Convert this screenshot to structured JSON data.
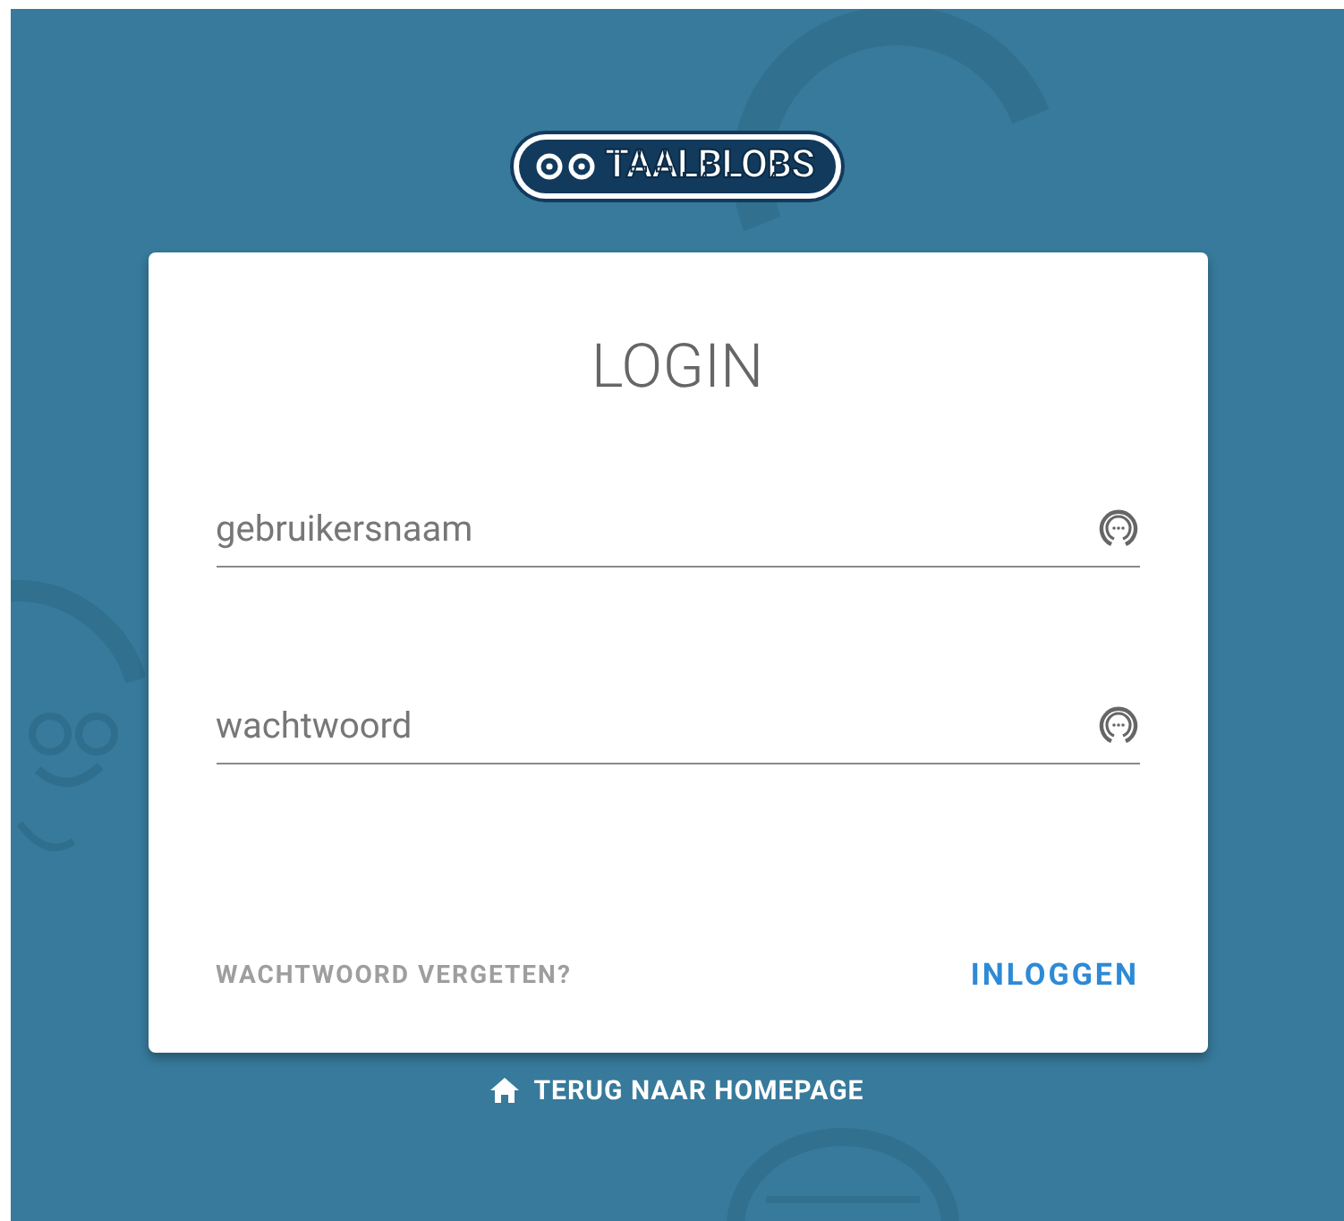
{
  "logo": {
    "text": "TAALBLOBS"
  },
  "login": {
    "title": "LOGIN",
    "fields": [
      {
        "placeholder": "gebruikersnaam"
      },
      {
        "placeholder": "wachtwoord"
      }
    ],
    "forgot": "WACHTWOORD VERGETEN?",
    "submit": "INLOGGEN"
  },
  "home_link": "TERUG NAAR HOMEPAGE"
}
